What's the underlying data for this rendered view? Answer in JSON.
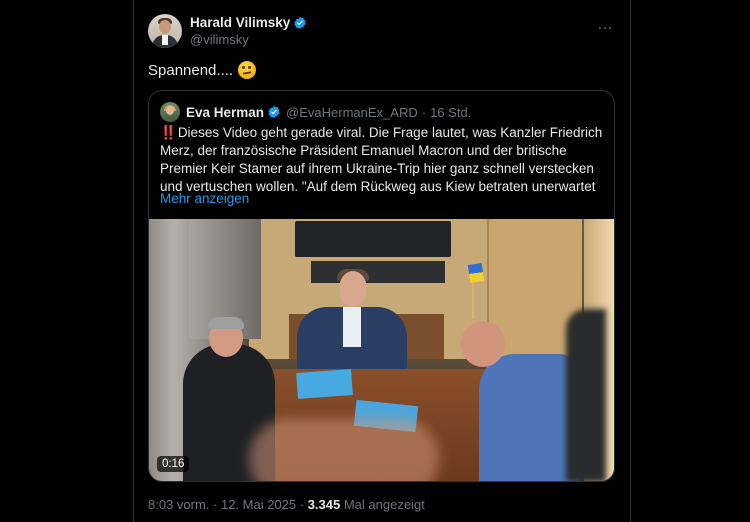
{
  "tweet": {
    "author": {
      "display_name": "Harald Vilimsky",
      "handle": "@vilimsky",
      "verified_icon": "verified-badge-icon"
    },
    "text": "Spannend....",
    "emoji": "thinking-face-emoji",
    "more_icon": "…",
    "meta": {
      "timestamp": "8:03 vorm. · 12. Mai 2025 · ",
      "views_count": "3.345",
      "views_label": " Mal angezeigt"
    }
  },
  "quote": {
    "author": {
      "display_name": "Eva Herman",
      "handle": "@EvaHermanEx_ARD",
      "separator": "·",
      "time": "16 Std."
    },
    "text_prefix": "‼️",
    "text": "Dieses Video geht gerade viral. Die Frage lautet, was Kanzler Friedrich Merz, der französische Präsident Emanuel Macron und der britische Premier Keir Stamer auf ihrem Ukraine-Trip hier ganz schnell verstecken und vertuschen wollen. \"Auf dem Rückweg aus Kiew betraten unerwartet",
    "show_more": "Mehr anzeigen",
    "video": {
      "duration": "0:16"
    }
  },
  "colors": {
    "background": "#000000",
    "text": "#e7e9ea",
    "secondary": "#71767b",
    "link": "#1d9bf0",
    "border": "#2f3336"
  }
}
